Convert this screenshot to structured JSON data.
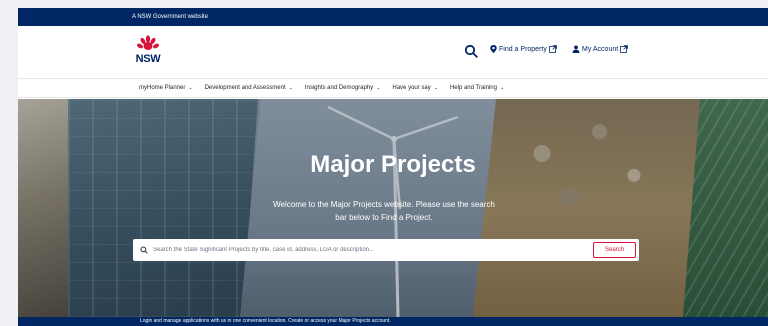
{
  "masthead": {
    "text": "A NSW Government website"
  },
  "header": {
    "logo_text": "NSW",
    "find_property_label": "Find a Property",
    "my_account_label": "My Account"
  },
  "nav": {
    "items": [
      {
        "label": "myHome Planner"
      },
      {
        "label": "Development and Assessment"
      },
      {
        "label": "Insights and Demography"
      },
      {
        "label": "Have your say"
      },
      {
        "label": "Help and Training"
      }
    ]
  },
  "hero": {
    "title": "Major Projects",
    "subtitle": "Welcome to the Major Projects website. Please use the search bar below to Find a Project.",
    "search": {
      "placeholder": "Search the State Significant Projects by title, case id, address, LGA or description...",
      "button_label": "Search"
    }
  },
  "banner": {
    "text": "Login and manage applications with us in one convenient location. Create or access your Major Projects account."
  },
  "colors": {
    "brand_navy": "#002664",
    "brand_red": "#d7153a"
  }
}
